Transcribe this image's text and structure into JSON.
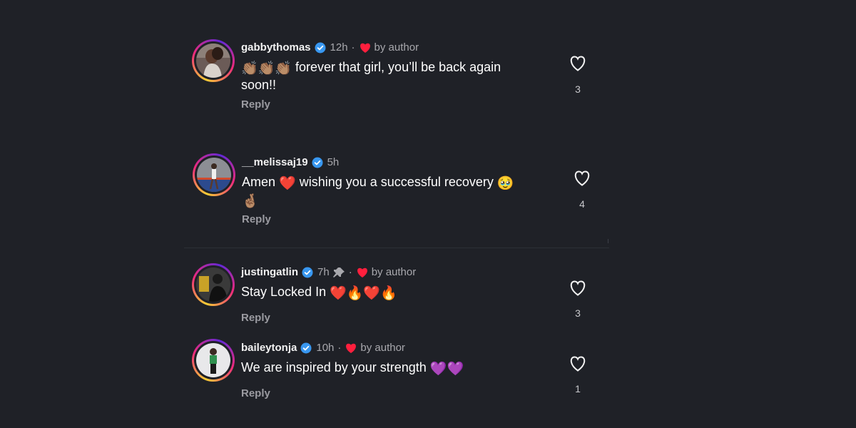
{
  "comments": [
    {
      "username": "gabbythomas",
      "time": "12h",
      "author_liked": true,
      "author_label": "by author",
      "pinned": false,
      "emoji_prefix": "👏🏽👏🏽👏🏽",
      "text_line1": "forever that girl, you’ll be back again",
      "text_line2": "soon!!",
      "reply_label": "Reply",
      "likes": "3"
    },
    {
      "username": "__melissaj19",
      "time": "5h",
      "author_liked": false,
      "author_label": "",
      "pinned": false,
      "text_line1_a": "Amen",
      "text_line1_heart": "❤️",
      "text_line1_b": "wishing you a successful recovery",
      "text_line1_emoji": "🥹",
      "text_line2": "🤞🏽",
      "reply_label": "Reply",
      "likes": "4"
    },
    {
      "username": "justingatlin",
      "time": "7h",
      "author_liked": true,
      "author_label": "by author",
      "pinned": true,
      "text": "Stay Locked In",
      "emoji_suffix": "❤️🔥❤️🔥",
      "reply_label": "Reply",
      "likes": "3"
    },
    {
      "username": "baileytonja",
      "time": "10h",
      "author_liked": true,
      "author_label": "by author",
      "pinned": false,
      "text": "We are inspired by your strength",
      "emoji_suffix": "💜💜",
      "reply_label": "Reply",
      "likes": "1"
    }
  ],
  "colors": {
    "background": "#1f2127",
    "verified": "#3897f0",
    "author_heart": "#ff1f3d",
    "muted_text": "#a8a8ad"
  },
  "icons": {
    "verified": "verified-badge-icon",
    "like": "heart-outline-icon",
    "author_like": "heart-filled-icon",
    "pin": "pin-icon"
  }
}
